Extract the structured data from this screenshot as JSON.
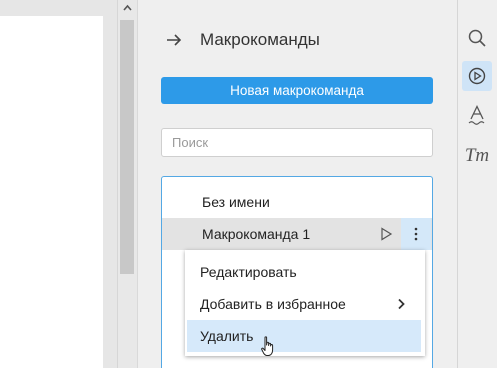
{
  "panel": {
    "title": "Макрокоманды",
    "new_button_label": "Новая макрокоманда",
    "search_placeholder": "Поиск"
  },
  "macros": {
    "items": [
      {
        "label": "Без имени"
      },
      {
        "label": "Макрокоманда 1"
      }
    ]
  },
  "context_menu": {
    "items": [
      {
        "label": "Редактировать"
      },
      {
        "label": "Добавить в избранное",
        "has_submenu": true
      },
      {
        "label": "Удалить",
        "hovered": true
      }
    ]
  },
  "toolbar": {
    "icons": [
      "search-icon",
      "macro-play-icon",
      "text-style-icon",
      "font-icon"
    ],
    "active": "macro-play-icon",
    "font_icon_text": "Tт"
  },
  "colors": {
    "accent": "#2d9ae8",
    "selected_row": "#e3e3e3",
    "hover_item": "#d6e9fa"
  }
}
